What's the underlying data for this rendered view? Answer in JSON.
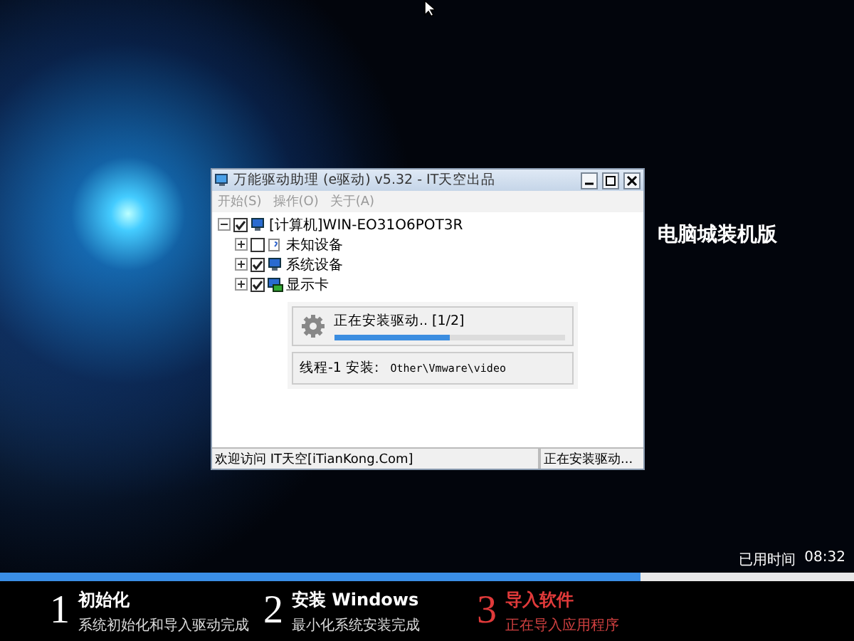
{
  "window": {
    "title": "万能驱动助理 (e驱动) v5.32 - IT天空出品",
    "menu": [
      "开始(S)",
      "操作(O)",
      "关于(A)"
    ],
    "tree": {
      "label": "[计算机]WIN-EO31O6POT3R",
      "kind": "computer",
      "checked": true,
      "expanded": true,
      "children": [
        {
          "label": "未知设备",
          "kind": "unknown",
          "checked": false,
          "expanded": false
        },
        {
          "label": "系统设备",
          "kind": "computer",
          "checked": true,
          "expanded": false
        },
        {
          "label": "显示卡",
          "kind": "display",
          "checked": true,
          "expanded": false
        }
      ]
    },
    "install_panel": {
      "title": "正在安装驱动.. [1/2]",
      "level": 0.5,
      "thread_label": "线程-1 安装:",
      "thread_path": "Other\\Vmware\\video"
    },
    "status_bar": [
      "欢迎访问 IT天空[iTianKong.Com]",
      "正在安装驱动..."
    ]
  },
  "banner_text": "电脑城装机版",
  "footer": {
    "elapsed_label": "已用时间",
    "elapsed_time": "08:32",
    "progress": {
      "level": 0.75
    },
    "steps": [
      {
        "number": "1",
        "title": "初始化",
        "subtitle": "系统初始化和导入驱动完成",
        "active": false
      },
      {
        "number": "2",
        "title": "安装 Windows",
        "subtitle": "最小化系统安装完成",
        "active": false
      },
      {
        "number": "3",
        "title": "导入软件",
        "subtitle": "正在导入应用程序",
        "active": true
      }
    ]
  }
}
